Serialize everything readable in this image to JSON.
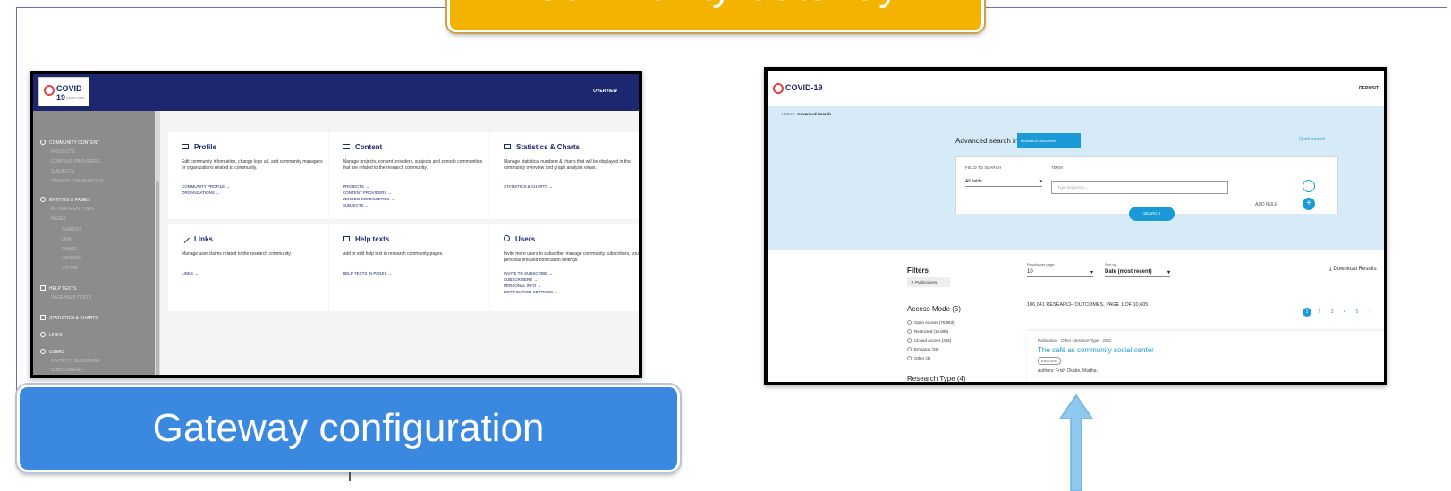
{
  "top_banner": {
    "text": "Community Gateway"
  },
  "bottom_label": {
    "text": "Gateway configuration"
  },
  "admin": {
    "logo_text": "COVID-19",
    "logo_sub": "United data",
    "nav_overview": "OVERVIEW",
    "sidebar": {
      "community_content": "COMMUNITY CONTENT",
      "projects": "PROJECTS",
      "content_providers": "CONTENT PROVIDERS",
      "subjects": "SUBJECTS",
      "zenodo": "ZENODO COMMUNITIES",
      "entities_pages": "ENTITIES & PAGES",
      "activate_entities": "ACTIVATE ENTITIES",
      "pages": "PAGES",
      "search": "SEARCH",
      "link": "LINK",
      "share": "SHARE",
      "landing": "LANDING",
      "other": "OTHER",
      "help_texts": "HELP TEXTS",
      "page_help_texts": "PAGE HELP TEXTS",
      "statistics_charts": "STATISTICS & CHARTS",
      "links": "LINKS",
      "users": "USERS",
      "invite": "INVITE TO SUBSCRIBE",
      "subscribers": "SUBSCRIBERS"
    },
    "cards": {
      "profile": {
        "title": "Profile",
        "desc": "Edit community information, change logo url, add community managers or organizations related to community.",
        "link1": "COMMUNITY PROFILE →",
        "link2": "ORGANIZATIONS →"
      },
      "content": {
        "title": "Content",
        "desc": "Manage projects, content providers, subjects and zenodo communities that are related to the research community.",
        "link1": "PROJECTS →",
        "link2": "CONTENT PROVIDERS →",
        "link3": "ZENODO COMMUNITIES →",
        "link4": "SUBJECTS →"
      },
      "statistics": {
        "title": "Statistics & Charts",
        "desc": "Manage statistical numbers & charts that will be displayed in the community overview and graph analysis views.",
        "link1": "STATISTICS & CHARTS →"
      },
      "links": {
        "title": "Links",
        "desc": "Manage user claims related to the research community.",
        "link1": "LINKS →"
      },
      "help": {
        "title": "Help texts",
        "desc": "Add or edit help text in research community pages.",
        "link1": "HELP TEXTS IN PAGES →"
      },
      "users": {
        "title": "Users",
        "desc": "Invite more users to subscribe, manage community subscribers, your personal info and notification settings.",
        "link1": "INVITE TO SUBSCRIBE →",
        "link2": "SUBSCRIBERS →",
        "link3": "PERSONAL INFO →",
        "link4": "NOTIFICATION SETTINGS →"
      }
    }
  },
  "public": {
    "logo_text": "COVID-19",
    "deposit": "DEPOSIT",
    "breadcrumb_home": "Home  >  ",
    "breadcrumb_current": "Advanced Search",
    "adv_label": "Advanced search in",
    "adv_scope": "Research outcomes",
    "quick_search": "Quick search",
    "field_label": "FIELD TO SEARCH",
    "term_label": "TERM",
    "field_value": "All fields",
    "term_placeholder": "Type keywords...",
    "add_rule": "ADD RULE",
    "search_btn": "SEARCH",
    "filters": "Filters",
    "chip": "✕  Publications",
    "access_mode": "Access Mode (5)",
    "access_options": [
      "Open Access (70,953)",
      "Restricted (10,800)",
      "Closed Access (355)",
      "Embargo (26)",
      "Other (3)"
    ],
    "research_type": "Research Type (4)",
    "rpp_label": "Results per page:",
    "rpp_value": "10",
    "sort_label": "Sort by:",
    "sort_value": "Date (most recent)",
    "download": "⤓  Download Results",
    "count": "106,041 RESEARCH OUTCOMES, PAGE 1 OF 10,605",
    "pages": [
      "1",
      "2",
      "3",
      "4",
      "5",
      "›"
    ],
    "result": {
      "meta": "Publication · Other Literature Type · 2022",
      "title": "The café as community social center",
      "lang": "ENGLISH",
      "authors": "Authors: Frish Okabe, Martha;"
    }
  },
  "colors": {
    "banner_yellow": "#f5b301",
    "label_blue": "#3b88e0",
    "admin_navy": "#1d2770",
    "accent_blue": "#1a9bd7",
    "arrow_blue": "#8ec8ec"
  }
}
